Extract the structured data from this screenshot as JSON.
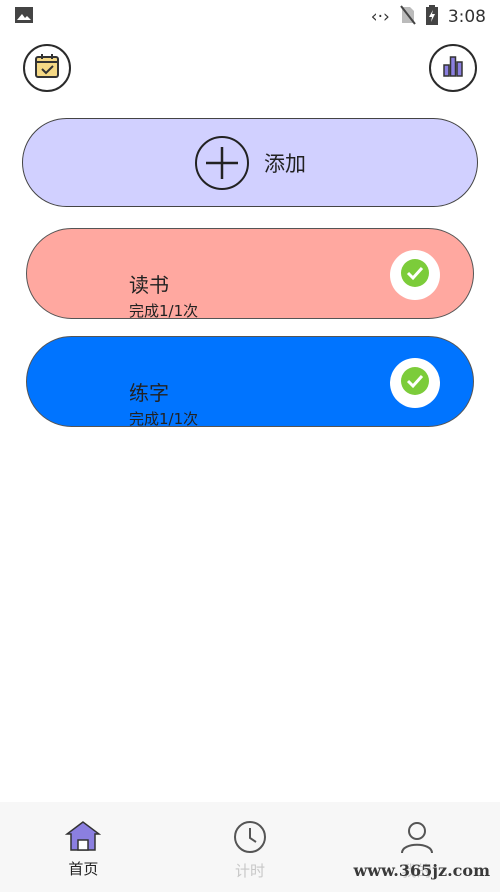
{
  "status_bar": {
    "time": "3:08",
    "icons": [
      "image-icon",
      "code-icon",
      "no-sim-icon",
      "battery-charging-icon"
    ]
  },
  "header": {
    "left_icon": "calendar-check-icon",
    "right_icon": "bar-chart-icon"
  },
  "add_card": {
    "label": "添加",
    "icon": "plus-circle-icon",
    "color": "#d1d0ff"
  },
  "habits": [
    {
      "title": "读书",
      "progress": "完成1/1次",
      "color": "#ffa8a0",
      "completed": true
    },
    {
      "title": "练字",
      "progress": "完成1/1次",
      "color": "#0074ff",
      "completed": true
    }
  ],
  "bottom_nav": {
    "items": [
      {
        "label": "首页",
        "icon": "home-icon",
        "active": true
      },
      {
        "label": "计时",
        "icon": "clock-icon",
        "active": false
      },
      {
        "label": "我的",
        "icon": "user-icon",
        "active": false
      }
    ]
  },
  "watermark": "www.365jz.com",
  "colors": {
    "accent": "#8b7fe0",
    "check": "#7ccc3a"
  }
}
